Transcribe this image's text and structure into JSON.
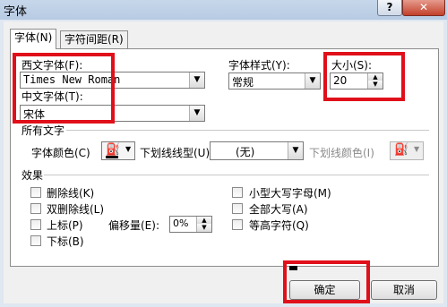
{
  "window": {
    "title": "字体",
    "help": "?",
    "close": "✕"
  },
  "tabs": [
    {
      "label": "字体(N)"
    },
    {
      "label": "字符间距(R)"
    }
  ],
  "font": {
    "western_label": "西文字体(F):",
    "western_value": "Times New Roman",
    "chinese_label": "中文字体(T):",
    "chinese_value": "宋体",
    "style_label": "字体样式(Y):",
    "style_value": "常规",
    "size_label": "大小(S):",
    "size_value": "20"
  },
  "all_text": {
    "section": "所有文字",
    "color_label": "字体颜色(C)",
    "underline_label": "下划线线型(U):",
    "underline_value": "(无)",
    "underline_color_label": "下划线颜色(I)"
  },
  "effects": {
    "section": "效果",
    "strikethrough": "删除线(K)",
    "double_strikethrough": "双删除线(L)",
    "superscript": "上标(P)",
    "subscript": "下标(B)",
    "offset_label": "偏移量(E):",
    "offset_value": "0%",
    "small_caps": "小型大写字母(M)",
    "all_caps": "全部大写(A)",
    "equalize_height": "等高字符(Q)"
  },
  "buttons": {
    "ok": "确定",
    "cancel": "取消"
  }
}
